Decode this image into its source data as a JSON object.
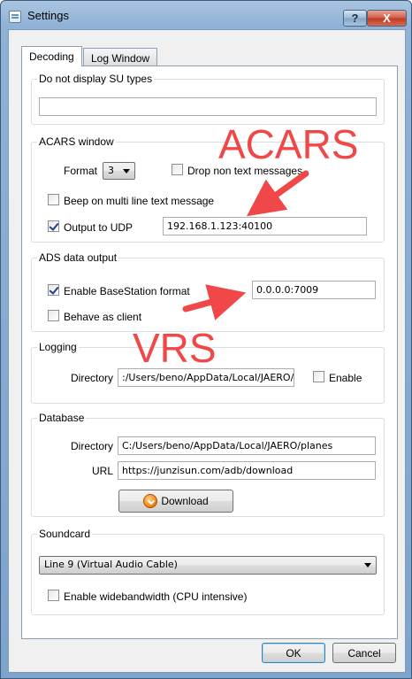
{
  "window": {
    "title": "Settings",
    "help_label": "?",
    "close_label": "X"
  },
  "tabs": [
    {
      "label": "Decoding"
    },
    {
      "label": "Log Window"
    }
  ],
  "su_types": {
    "title": "Do not display SU types",
    "value": ""
  },
  "acars": {
    "title": "ACARS window",
    "format_label": "Format",
    "format_value": "3",
    "drop_non_text_label": "Drop non text messages",
    "drop_non_text_checked": false,
    "beep_label": "Beep on multi line text message",
    "beep_checked": false,
    "udp_label": "Output to UDP",
    "udp_checked": true,
    "udp_value": "192.168.1.123:40100"
  },
  "ads": {
    "title": "ADS data output",
    "basestation_label": "Enable BaseStation format",
    "basestation_checked": true,
    "basestation_value": "0.0.0.0:7009",
    "client_label": "Behave as client",
    "client_checked": false
  },
  "logging": {
    "title": "Logging",
    "directory_label": "Directory",
    "directory_value": ":/Users/beno/AppData/Local/JAERO/logs",
    "enable_label": "Enable",
    "enable_checked": false
  },
  "database": {
    "title": "Database",
    "directory_label": "Directory",
    "directory_value": "C:/Users/beno/AppData/Local/JAERO/planes",
    "url_label": "URL",
    "url_value": "https://junzisun.com/adb/download",
    "download_label": "Download"
  },
  "soundcard": {
    "title": "Soundcard",
    "device_value": "Line 9 (Virtual Audio Cable)",
    "wideband_label": "Enable widebandwidth (CPU intensive)",
    "wideband_checked": false
  },
  "buttons": {
    "ok_label": "OK",
    "cancel_label": "Cancel"
  },
  "annotations": {
    "acars_text": "ACARS",
    "vrs_text": "VRS",
    "color": "#f04848"
  }
}
